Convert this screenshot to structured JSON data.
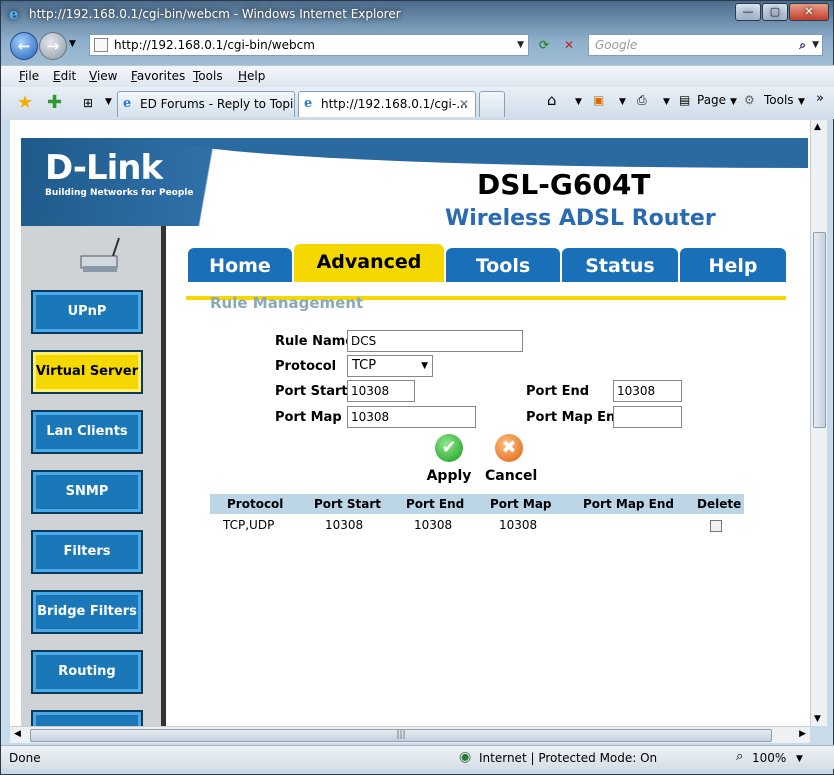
{
  "window": {
    "title": "http://192.168.0.1/cgi-bin/webcm - Windows Internet Explorer",
    "controls": {
      "min": "—",
      "max": "▢",
      "close": "✕"
    }
  },
  "navbar": {
    "address": "http://192.168.0.1/cgi-bin/webcm",
    "search_placeholder": "Google"
  },
  "menu": [
    "File",
    "Edit",
    "View",
    "Favorites",
    "Tools",
    "Help"
  ],
  "tabs": [
    {
      "label": "ED Forums - Reply to Topic"
    },
    {
      "label": "http://192.168.0.1/cgi-..."
    }
  ],
  "toolbar": {
    "page": "Page",
    "tools": "Tools"
  },
  "status": {
    "left": "Done",
    "zone": "Internet | Protected Mode: On",
    "zoom": "100%"
  },
  "page": {
    "brand": "D-Link",
    "tagline": "Building Networks for People",
    "model": "DSL-G604T",
    "subtitle": "Wireless ADSL Router",
    "sidebar": [
      "UPnP",
      "Virtual Server",
      "Lan Clients",
      "SNMP",
      "Filters",
      "Bridge Filters",
      "Routing"
    ],
    "topnav": [
      "Home",
      "Advanced",
      "Tools",
      "Status",
      "Help"
    ],
    "section_title": "Rule Management",
    "form": {
      "rule_name_label": "Rule Name",
      "rule_name_value": "DCS",
      "protocol_label": "Protocol",
      "protocol_value": "TCP",
      "port_start_label": "Port Start",
      "port_start_value": "10308",
      "port_end_label": "Port End",
      "port_end_value": "10308",
      "port_map_label": "Port Map",
      "port_map_value": "10308",
      "port_map_end_label": "Port Map End",
      "port_map_end_value": ""
    },
    "actions": {
      "apply": "Apply",
      "cancel": "Cancel"
    },
    "table": {
      "headers": [
        "Protocol",
        "Port Start",
        "Port End",
        "Port Map",
        "Port Map End",
        "Delete"
      ],
      "rows": [
        [
          "TCP,UDP",
          "10308",
          "10308",
          "10308",
          ""
        ]
      ]
    }
  }
}
